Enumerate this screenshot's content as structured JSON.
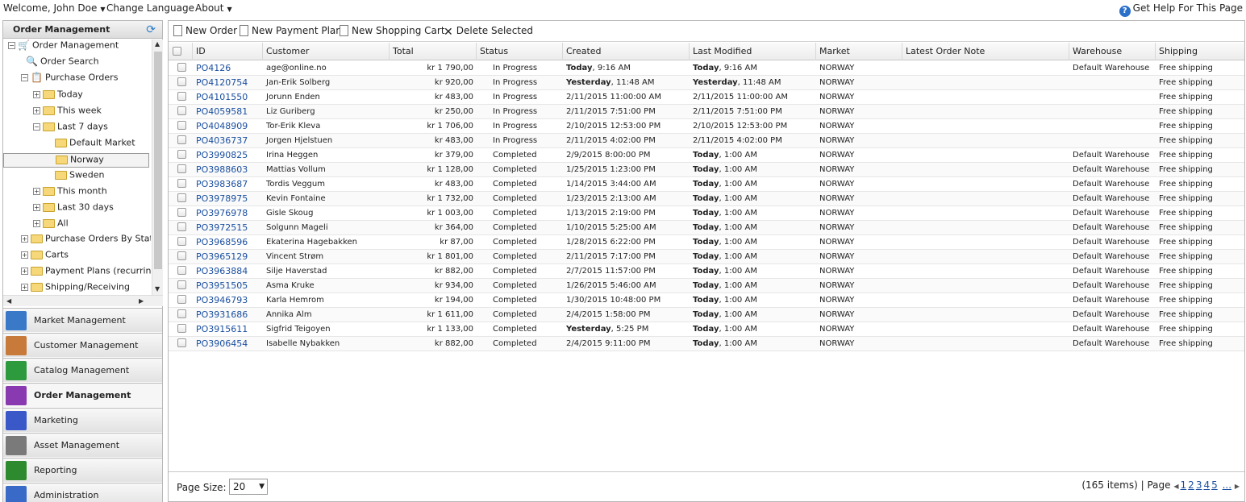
{
  "topbar": {
    "welcome": "Welcome, John Doe",
    "change_language": "Change Language",
    "about": "About",
    "help": "Get Help For This Page"
  },
  "left": {
    "title": "Order Management",
    "tree": [
      {
        "label": "Order Management",
        "icon": "cart-icon"
      },
      {
        "label": "Order Search",
        "icon": "magnifier-icon"
      },
      {
        "label": "Purchase Orders",
        "icon": "clipboard-icon"
      },
      {
        "label": "Today",
        "icon": "folder-icon"
      },
      {
        "label": "This week",
        "icon": "folder-icon"
      },
      {
        "label": "Last 7 days",
        "icon": "folder-icon"
      },
      {
        "label": "Default Market",
        "icon": "folder-icon"
      },
      {
        "label": "Norway",
        "icon": "folder-icon"
      },
      {
        "label": "Sweden",
        "icon": "folder-icon"
      },
      {
        "label": "This month",
        "icon": "folder-icon"
      },
      {
        "label": "Last 30 days",
        "icon": "folder-icon"
      },
      {
        "label": "All",
        "icon": "folder-icon"
      },
      {
        "label": "Purchase Orders By Stat",
        "icon": "folder-icon"
      },
      {
        "label": "Carts",
        "icon": "folder-icon"
      },
      {
        "label": "Payment Plans (recurrin",
        "icon": "folder-icon"
      },
      {
        "label": "Shipping/Receiving",
        "icon": "folder-icon"
      }
    ],
    "modules": [
      {
        "label": "Market Management",
        "color": "#3a78c8"
      },
      {
        "label": "Customer Management",
        "color": "#c87a3a"
      },
      {
        "label": "Catalog Management",
        "color": "#2e9a3e"
      },
      {
        "label": "Order Management",
        "color": "#8a3ab0"
      },
      {
        "label": "Marketing",
        "color": "#3a58c8"
      },
      {
        "label": "Asset Management",
        "color": "#7a7a7a"
      },
      {
        "label": "Reporting",
        "color": "#2e8a2e"
      },
      {
        "label": "Administration",
        "color": "#3a6ac8"
      }
    ]
  },
  "toolbar": {
    "new_order": "New Order",
    "new_payment_plan": "New Payment Plan",
    "new_shopping_cart": "New Shopping Cart",
    "delete_selected": "Delete Selected"
  },
  "grid": {
    "columns": [
      "ID",
      "Customer",
      "Total",
      "Status",
      "Created",
      "Last Modified",
      "Market",
      "Latest Order Note",
      "Warehouse",
      "Shipping"
    ],
    "rows": [
      {
        "id": "PO4126",
        "customer": "age@online.no",
        "total": "kr 1 790,00",
        "status": "In Progress",
        "created_b": "Today",
        "created": ", 9:16 AM",
        "mod_b": "Today",
        "mod": ", 9:16 AM",
        "market": "NORWAY",
        "note": "",
        "warehouse": "Default Warehouse",
        "shipping": "Free shipping"
      },
      {
        "id": "PO4120754",
        "customer": "Jan-Erik Solberg",
        "total": "kr 920,00",
        "status": "In Progress",
        "created_b": "Yesterday",
        "created": ", 11:48 AM",
        "mod_b": "Yesterday",
        "mod": ", 11:48 AM",
        "market": "NORWAY",
        "note": "",
        "warehouse": "",
        "shipping": "Free shipping"
      },
      {
        "id": "PO4101550",
        "customer": "Jorunn Enden",
        "total": "kr 483,00",
        "status": "In Progress",
        "created_b": "",
        "created": "2/11/2015 11:00:00 AM",
        "mod_b": "",
        "mod": "2/11/2015 11:00:00 AM",
        "market": "NORWAY",
        "note": "",
        "warehouse": "",
        "shipping": "Free shipping"
      },
      {
        "id": "PO4059581",
        "customer": "Liz Guriberg",
        "total": "kr 250,00",
        "status": "In Progress",
        "created_b": "",
        "created": "2/11/2015 7:51:00 PM",
        "mod_b": "",
        "mod": "2/11/2015 7:51:00 PM",
        "market": "NORWAY",
        "note": "",
        "warehouse": "",
        "shipping": "Free shipping"
      },
      {
        "id": "PO4048909",
        "customer": "Tor-Erik Kleva",
        "total": "kr 1 706,00",
        "status": "In Progress",
        "created_b": "",
        "created": "2/10/2015 12:53:00 PM",
        "mod_b": "",
        "mod": "2/10/2015 12:53:00 PM",
        "market": "NORWAY",
        "note": "",
        "warehouse": "",
        "shipping": "Free shipping"
      },
      {
        "id": "PO4036737",
        "customer": "Jorgen Hjelstuen",
        "total": "kr 483,00",
        "status": "In Progress",
        "created_b": "",
        "created": "2/11/2015 4:02:00 PM",
        "mod_b": "",
        "mod": "2/11/2015 4:02:00 PM",
        "market": "NORWAY",
        "note": "",
        "warehouse": "",
        "shipping": "Free shipping"
      },
      {
        "id": "PO3990825",
        "customer": "Irina Heggen",
        "total": "kr 379,00",
        "status": "Completed",
        "created_b": "",
        "created": "2/9/2015 8:00:00 PM",
        "mod_b": "Today",
        "mod": ", 1:00 AM",
        "market": "NORWAY",
        "note": "",
        "warehouse": "Default Warehouse",
        "shipping": "Free shipping"
      },
      {
        "id": "PO3988603",
        "customer": "Mattias Vollum",
        "total": "kr 1 128,00",
        "status": "Completed",
        "created_b": "",
        "created": "1/25/2015 1:23:00 PM",
        "mod_b": "Today",
        "mod": ", 1:00 AM",
        "market": "NORWAY",
        "note": "",
        "warehouse": "Default Warehouse",
        "shipping": "Free shipping"
      },
      {
        "id": "PO3983687",
        "customer": "Tordis Veggum",
        "total": "kr 483,00",
        "status": "Completed",
        "created_b": "",
        "created": "1/14/2015 3:44:00 AM",
        "mod_b": "Today",
        "mod": ", 1:00 AM",
        "market": "NORWAY",
        "note": "",
        "warehouse": "Default Warehouse",
        "shipping": "Free shipping"
      },
      {
        "id": "PO3978975",
        "customer": "Kevin Fontaine",
        "total": "kr 1 732,00",
        "status": "Completed",
        "created_b": "",
        "created": "1/23/2015 2:13:00 AM",
        "mod_b": "Today",
        "mod": ", 1:00 AM",
        "market": "NORWAY",
        "note": "",
        "warehouse": "Default Warehouse",
        "shipping": "Free shipping"
      },
      {
        "id": "PO3976978",
        "customer": "Gisle Skoug",
        "total": "kr 1 003,00",
        "status": "Completed",
        "created_b": "",
        "created": "1/13/2015 2:19:00 PM",
        "mod_b": "Today",
        "mod": ", 1:00 AM",
        "market": "NORWAY",
        "note": "",
        "warehouse": "Default Warehouse",
        "shipping": "Free shipping"
      },
      {
        "id": "PO3972515",
        "customer": "Solgunn Mageli",
        "total": "kr 364,00",
        "status": "Completed",
        "created_b": "",
        "created": "1/10/2015 5:25:00 AM",
        "mod_b": "Today",
        "mod": ", 1:00 AM",
        "market": "NORWAY",
        "note": "",
        "warehouse": "Default Warehouse",
        "shipping": "Free shipping"
      },
      {
        "id": "PO3968596",
        "customer": "Ekaterina Hagebakken",
        "total": "kr 87,00",
        "status": "Completed",
        "created_b": "",
        "created": "1/28/2015 6:22:00 PM",
        "mod_b": "Today",
        "mod": ", 1:00 AM",
        "market": "NORWAY",
        "note": "",
        "warehouse": "Default Warehouse",
        "shipping": "Free shipping"
      },
      {
        "id": "PO3965129",
        "customer": "Vincent Strøm",
        "total": "kr 1 801,00",
        "status": "Completed",
        "created_b": "",
        "created": "2/11/2015 7:17:00 PM",
        "mod_b": "Today",
        "mod": ", 1:00 AM",
        "market": "NORWAY",
        "note": "",
        "warehouse": "Default Warehouse",
        "shipping": "Free shipping"
      },
      {
        "id": "PO3963884",
        "customer": "Silje Haverstad",
        "total": "kr 882,00",
        "status": "Completed",
        "created_b": "",
        "created": "2/7/2015 11:57:00 PM",
        "mod_b": "Today",
        "mod": ", 1:00 AM",
        "market": "NORWAY",
        "note": "",
        "warehouse": "Default Warehouse",
        "shipping": "Free shipping"
      },
      {
        "id": "PO3951505",
        "customer": "Asma Kruke",
        "total": "kr 934,00",
        "status": "Completed",
        "created_b": "",
        "created": "1/26/2015 5:46:00 AM",
        "mod_b": "Today",
        "mod": ", 1:00 AM",
        "market": "NORWAY",
        "note": "",
        "warehouse": "Default Warehouse",
        "shipping": "Free shipping"
      },
      {
        "id": "PO3946793",
        "customer": "Karla Hemrom",
        "total": "kr 194,00",
        "status": "Completed",
        "created_b": "",
        "created": "1/30/2015 10:48:00 PM",
        "mod_b": "Today",
        "mod": ", 1:00 AM",
        "market": "NORWAY",
        "note": "",
        "warehouse": "Default Warehouse",
        "shipping": "Free shipping"
      },
      {
        "id": "PO3931686",
        "customer": "Annika Alm",
        "total": "kr 1 611,00",
        "status": "Completed",
        "created_b": "",
        "created": "2/4/2015 1:58:00 PM",
        "mod_b": "Today",
        "mod": ", 1:00 AM",
        "market": "NORWAY",
        "note": "",
        "warehouse": "Default Warehouse",
        "shipping": "Free shipping"
      },
      {
        "id": "PO3915611",
        "customer": "Sigfrid Teigoyen",
        "total": "kr 1 133,00",
        "status": "Completed",
        "created_b": "Yesterday",
        "created": ", 5:25 PM",
        "mod_b": "Today",
        "mod": ", 1:00 AM",
        "market": "NORWAY",
        "note": "",
        "warehouse": "Default Warehouse",
        "shipping": "Free shipping"
      },
      {
        "id": "PO3906454",
        "customer": "Isabelle Nybakken",
        "total": "kr 882,00",
        "status": "Completed",
        "created_b": "",
        "created": "2/4/2015 9:11:00 PM",
        "mod_b": "Today",
        "mod": ", 1:00 AM",
        "market": "NORWAY",
        "note": "",
        "warehouse": "Default Warehouse",
        "shipping": "Free shipping"
      }
    ]
  },
  "footer": {
    "page_size_label": "Page Size:",
    "page_size_value": "20",
    "items": "(165 items)",
    "separator": "|",
    "page_label": "Page",
    "pages": [
      "1",
      "2",
      "3",
      "4",
      "5"
    ],
    "more": "..."
  }
}
